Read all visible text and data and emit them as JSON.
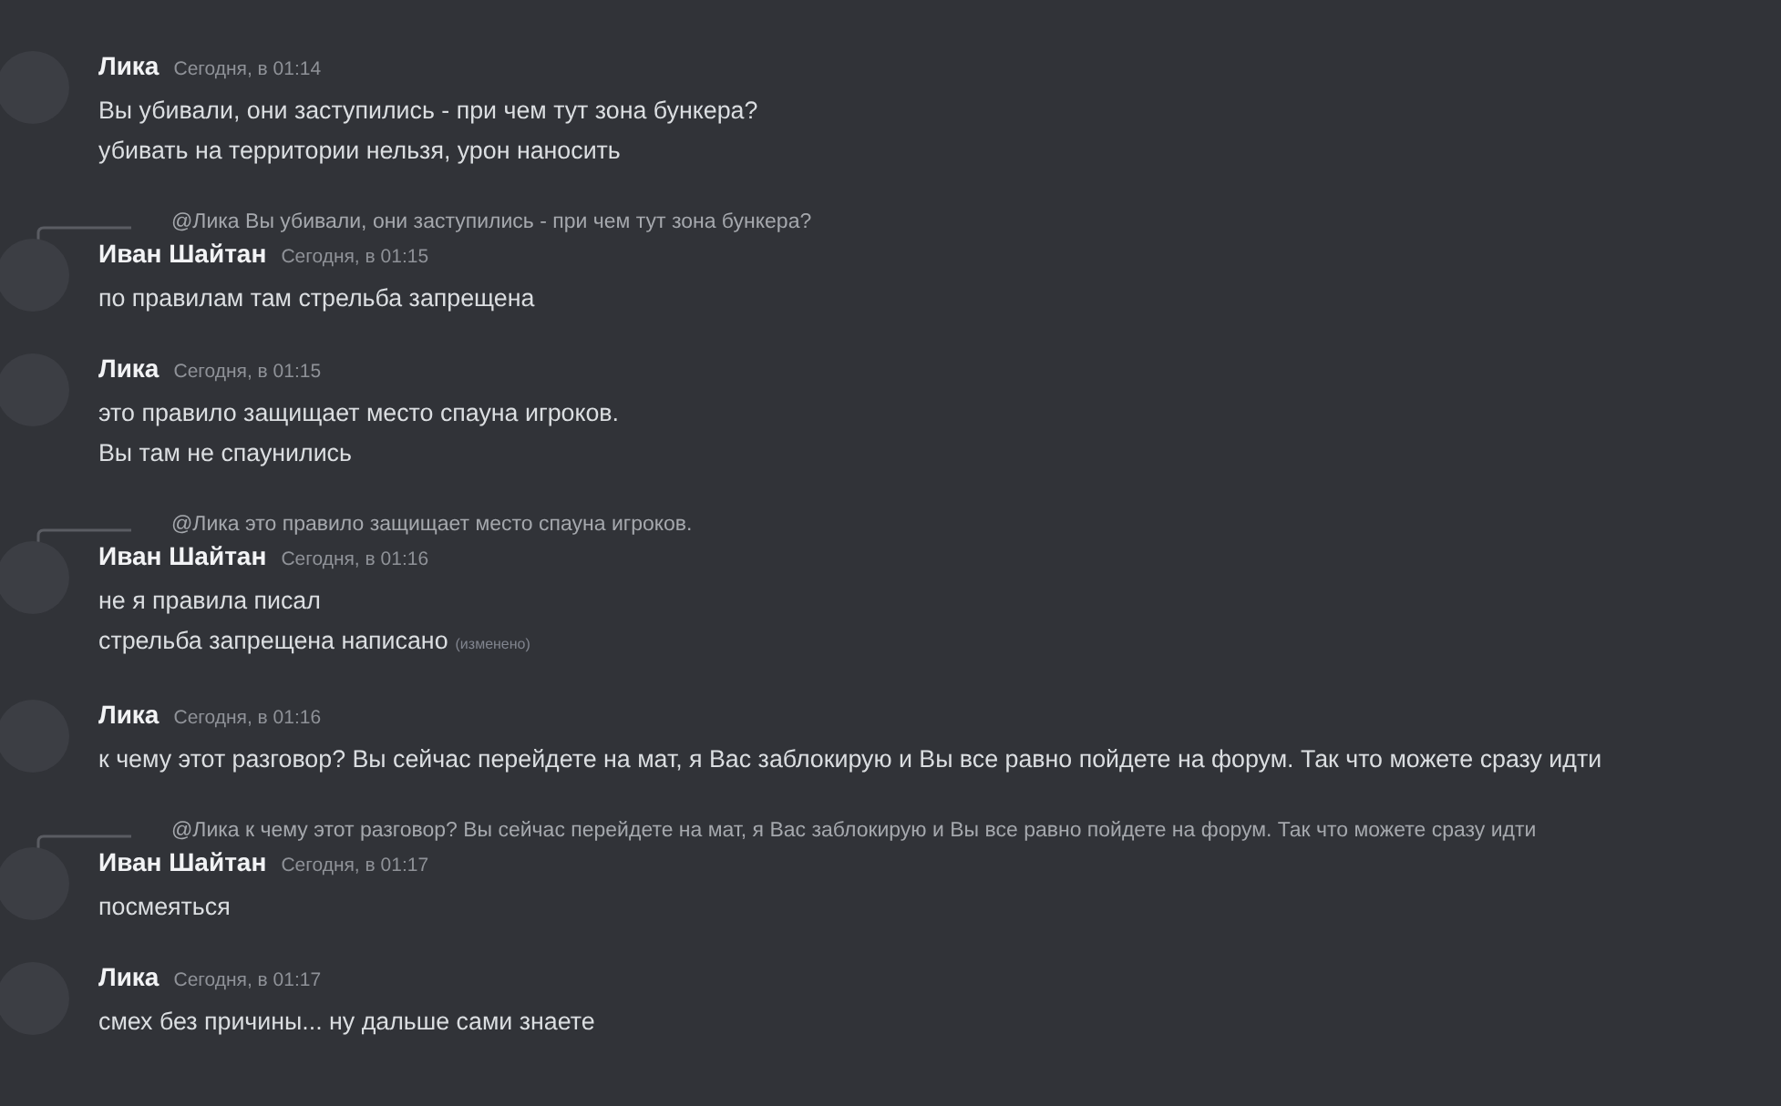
{
  "messages": [
    {
      "author": "Лика",
      "time": "Сегодня, в 01:14",
      "lines": [
        {
          "text": "Вы убивали, они заступились - при чем тут зона бункера?"
        },
        {
          "text": "убивать на территории нельзя, урон наносить"
        }
      ]
    },
    {
      "reply": "@Лика Вы убивали, они заступились - при чем тут зона бункера?",
      "author": "Иван Шайтан",
      "time": "Сегодня, в 01:15",
      "lines": [
        {
          "text": "по правилам там стрельба запрещена"
        }
      ]
    },
    {
      "author": "Лика",
      "time": "Сегодня, в 01:15",
      "lines": [
        {
          "text": "это правило защищает место спауна игроков."
        },
        {
          "text": "Вы там не спаунились"
        }
      ]
    },
    {
      "reply": "@Лика это правило защищает место спауна игроков.",
      "author": "Иван Шайтан",
      "time": "Сегодня, в 01:16",
      "lines": [
        {
          "text": "не я правила писал"
        },
        {
          "text": "стрельба запрещена написано",
          "edited": "(изменено)"
        }
      ]
    },
    {
      "author": "Лика",
      "time": "Сегодня, в 01:16",
      "lines": [
        {
          "text": "к чему этот разговор? Вы сейчас перейдете на мат, я Вас заблокирую и Вы все равно пойдете на форум. Так что можете сразу идти"
        }
      ]
    },
    {
      "reply": "@Лика к чему этот разговор? Вы сейчас перейдете на мат, я Вас заблокирую и Вы все равно пойдете на форум. Так что можете сразу идти",
      "author": "Иван Шайтан",
      "time": "Сегодня, в 01:17",
      "lines": [
        {
          "text": "посмеяться"
        }
      ]
    },
    {
      "author": "Лика",
      "time": "Сегодня, в 01:17",
      "lines": [
        {
          "text": "смех без причины... ну дальше сами знаете"
        }
      ]
    }
  ]
}
